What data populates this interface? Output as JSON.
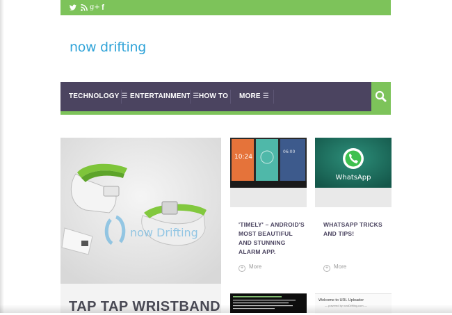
{
  "social": {
    "icons": [
      "twitter-icon",
      "rss-icon",
      "google-plus-icon",
      "facebook-icon"
    ],
    "google_plus_label": "g+",
    "facebook_label": "f"
  },
  "header": {
    "logo": "now drifting"
  },
  "nav": {
    "items": [
      {
        "label": "TECHNOLOGY",
        "has_submenu": true
      },
      {
        "label": "ENTERTAINMENT",
        "has_submenu": true
      },
      {
        "label": "HOW TO",
        "has_submenu": false
      },
      {
        "label": "MORE",
        "has_submenu": true
      }
    ],
    "submenu_icon": "☰",
    "search_icon": "search-icon"
  },
  "featured": {
    "title": "TAP TAP WRISTBAND",
    "watermark": "now Drifting"
  },
  "cards": [
    {
      "title": "'TIMELY' – ANDROID'S MOST BEAUTIFUL AND STUNNING ALARM APP.",
      "more": "More",
      "thumb_time": "10:24"
    },
    {
      "title": "WHATSAPP TRICKS AND TIPS!",
      "more": "More",
      "thumb_label": "WhatsApp"
    }
  ],
  "bottom_thumbs": {
    "uploader_title": "Welcome to URL Uploader",
    "uploader_sub": "— powered by nowDrifting.com —"
  },
  "colors": {
    "accent_green": "#7dc35a",
    "nav_purple": "#4b4460",
    "logo_blue": "#2fa3d8"
  }
}
